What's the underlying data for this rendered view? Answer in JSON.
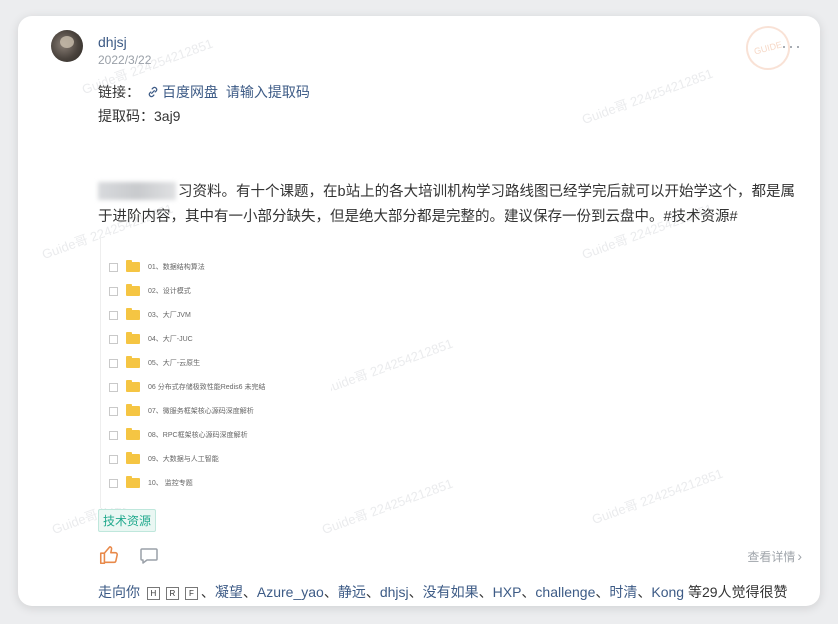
{
  "post": {
    "username": "dhjsj",
    "date": "2022/3/22",
    "more_label": "···",
    "link_label": "链接：",
    "link_text": "百度网盘",
    "link_hint": "请输入提取码",
    "code_line": "提取码：3aj9",
    "body_text": "习资料。有十个课题，在b站上的各大培训机构学习路线图已经学完后就可以开始学这个，都是属于进阶内容，其中有一小部分缺失，但是绝大部分都是完整的。建议保存一份到云盘中。#技术资源#",
    "tag": "技术资源",
    "detail_label": "查看详情",
    "detail_arrow": "›"
  },
  "watermark": "Guide哥 224254212851",
  "stamp": "GUIDE",
  "folders": [
    "01、数据结构算法",
    "02、设计模式",
    "03、大厂JVM",
    "04、大厂-JUC",
    "05、大厂-云原生",
    "06 分布式存储极致性能Redis6 未完结",
    "07、微服务框架核心源码深度解析",
    "08、RPC框架核心源码深度解析",
    "09、大数据与人工智能",
    "10、 监控专题"
  ],
  "likers": {
    "names": [
      "走向你",
      "H",
      "R",
      "F",
      "凝望",
      "Azure_yao",
      "静远",
      "dhjsj",
      "没有如果",
      "HXP",
      "challenge",
      "时清",
      "Kong"
    ],
    "sep": "、",
    "suffix": " 等29人觉得很赞"
  },
  "colors": {
    "link": "#3d5b86",
    "tag_text": "#21a98d",
    "like_icon": "#e8894a",
    "folder": "#f5c543"
  },
  "icons": [
    "link-icon",
    "thumbs-up-icon",
    "comment-icon",
    "more-icon",
    "chevron-right-icon",
    "folder-icon"
  ]
}
